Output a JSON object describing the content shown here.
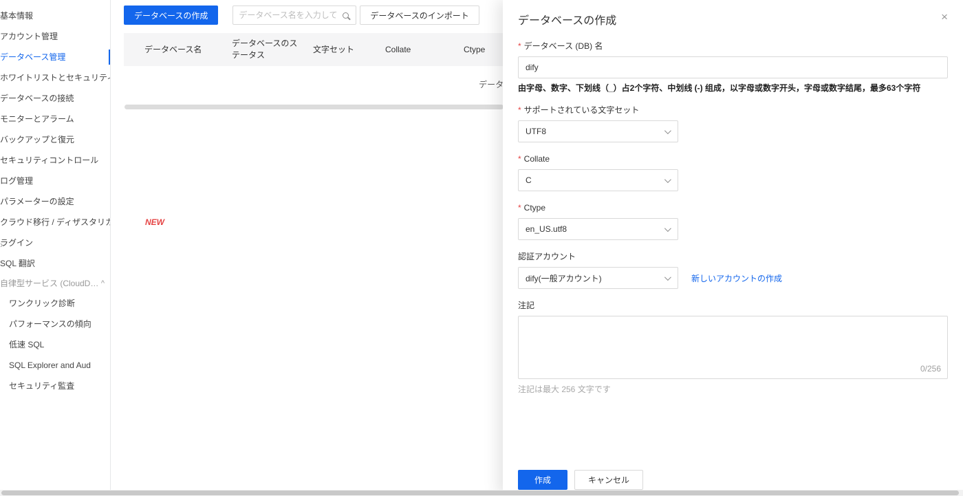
{
  "colors": {
    "primary": "#1366ec",
    "danger": "#e54545",
    "link": "#1366ec"
  },
  "sidebar": {
    "collapse_arrow": "›",
    "items": [
      {
        "label": "基本情報"
      },
      {
        "label": "アカウント管理"
      },
      {
        "label": "データベース管理"
      },
      {
        "label": "ホワイトリストとセキュリティ"
      },
      {
        "label": "データベースの接続"
      },
      {
        "label": "モニターとアラーム"
      },
      {
        "label": "バックアップと復元"
      },
      {
        "label": "セキュリティコントロール"
      },
      {
        "label": "ログ管理"
      },
      {
        "label": "パラメーターの設定"
      },
      {
        "label": "クラウド移行 / ディザスタリカバリ"
      },
      {
        "label": "ラグイン"
      },
      {
        "label": "SQL 翻訳"
      }
    ],
    "new_badge": "NEW",
    "group": {
      "label": "自律型サービス (CloudD…",
      "collapse_icon": "^"
    },
    "sub_items": [
      {
        "label": "ワンクリック診断"
      },
      {
        "label": "パフォーマンスの傾向"
      },
      {
        "label": "低速 SQL"
      },
      {
        "label": "SQL Explorer and Aud"
      },
      {
        "label": "セキュリティ監査"
      }
    ]
  },
  "toolbar": {
    "create_button": "データベースの作成",
    "search_placeholder": "データベース名を入力してく",
    "import_button": "データベースのインポート"
  },
  "table": {
    "columns": [
      "データベース名",
      "データベースのステータス",
      "文字セット",
      "Collate",
      "Ctype"
    ],
    "empty_text": "データがありません"
  },
  "drawer": {
    "title": "データベースの作成",
    "close_icon": "×",
    "required_mark": "*",
    "fields": {
      "db_name": {
        "label": "データベース (DB) 名",
        "value": "dify",
        "help": "由字母、数字、下划线（_）占2个字符、中划线 (-) 组成，以字母或数字开头，字母或数字结尾，最多63个字符"
      },
      "charset": {
        "label": "サポートされている文字セット",
        "value": "UTF8"
      },
      "collate": {
        "label": "Collate",
        "value": "C"
      },
      "ctype": {
        "label": "Ctype",
        "value": "en_US.utf8"
      },
      "account": {
        "label": "認証アカウント",
        "value": "dify(一般アカウント)",
        "link": "新しいアカウントの作成"
      },
      "note": {
        "label": "注記",
        "counter": "0/256",
        "help": "注記は最大 256 文字です"
      }
    },
    "footer": {
      "submit": "作成",
      "cancel": "キャンセル"
    }
  }
}
